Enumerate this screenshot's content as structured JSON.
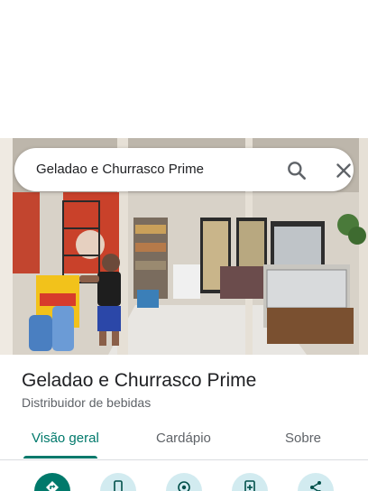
{
  "search": {
    "query": "Geladao e Churrasco Prime",
    "search_icon": "search-icon",
    "close_icon": "close-icon"
  },
  "place": {
    "name": "Geladao e Churrasco Prime",
    "category": "Distribuidor de bebidas"
  },
  "tabs": [
    {
      "label": "Visão geral",
      "active": true
    },
    {
      "label": "Cardápio",
      "active": false
    },
    {
      "label": "Sobre",
      "active": false
    }
  ],
  "actions": [
    {
      "icon": "directions-icon"
    },
    {
      "icon": "phone-icon"
    },
    {
      "icon": "location-icon"
    },
    {
      "icon": "add-to-list-icon"
    },
    {
      "icon": "share-icon"
    }
  ],
  "colors": {
    "accent": "#00796b",
    "action_bg": "#d2ebf0",
    "title": "#202124",
    "secondary": "#5f6368"
  }
}
